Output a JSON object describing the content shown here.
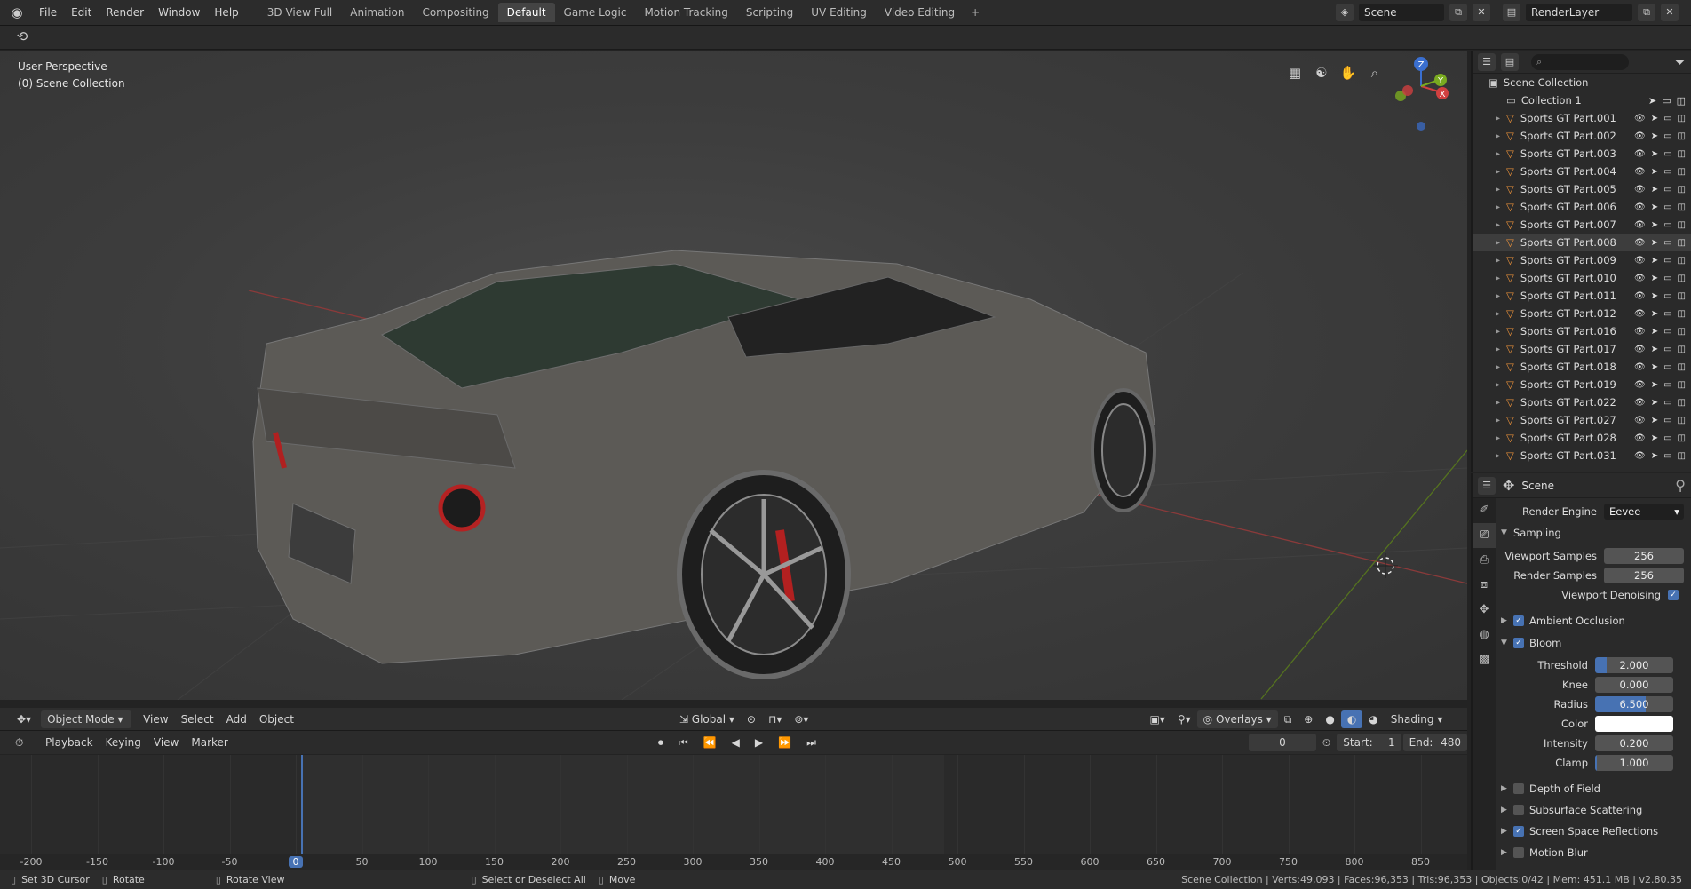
{
  "topbar": {
    "menus": [
      "File",
      "Edit",
      "Render",
      "Window",
      "Help"
    ],
    "workspaces": [
      "3D View Full",
      "Animation",
      "Compositing",
      "Default",
      "Game Logic",
      "Motion Tracking",
      "Scripting",
      "UV Editing",
      "Video Editing"
    ],
    "active_workspace": "Default",
    "add_label": "+",
    "scene": "Scene",
    "view_layer": "RenderLayer"
  },
  "viewport": {
    "perspective": "User Perspective",
    "collection": "(0) Scene Collection"
  },
  "vp_header": {
    "mode": "Object Mode",
    "menus": [
      "View",
      "Select",
      "Add",
      "Object"
    ],
    "orientation": "Global",
    "overlays": "Overlays",
    "shading": "Shading"
  },
  "timeline": {
    "menus": [
      "Playback",
      "Keying",
      "View",
      "Marker"
    ],
    "current_frame": "0",
    "start_label": "Start:",
    "start": "1",
    "end_label": "End:",
    "end": "480",
    "ruler": [
      "-200",
      "-150",
      "-100",
      "-50",
      "0",
      "50",
      "100",
      "150",
      "200",
      "250",
      "300",
      "350",
      "400",
      "450",
      "500",
      "550",
      "600",
      "650",
      "700",
      "750",
      "800",
      "850"
    ]
  },
  "statusbar": {
    "left": [
      {
        "label": "Set 3D Cursor"
      },
      {
        "label": "Rotate"
      },
      {
        "label": "Rotate View"
      },
      {
        "label": "Select or Deselect All"
      },
      {
        "label": "Move"
      }
    ],
    "stats": "Scene Collection | Verts:49,093 | Faces:96,353 | Tris:96,353 | Objects:0/42 | Mem: 451.1 MB | v2.80.35"
  },
  "outliner": {
    "root": "Scene Collection",
    "collection": "Collection 1",
    "items": [
      "Sports GT Part.001",
      "Sports GT Part.002",
      "Sports GT Part.003",
      "Sports GT Part.004",
      "Sports GT Part.005",
      "Sports GT Part.006",
      "Sports GT Part.007",
      "Sports GT Part.008",
      "Sports GT Part.009",
      "Sports GT Part.010",
      "Sports GT Part.011",
      "Sports GT Part.012",
      "Sports GT Part.016",
      "Sports GT Part.017",
      "Sports GT Part.018",
      "Sports GT Part.019",
      "Sports GT Part.022",
      "Sports GT Part.027",
      "Sports GT Part.028",
      "Sports GT Part.031"
    ],
    "selected_index": 7
  },
  "properties": {
    "context": "Scene",
    "render_engine_label": "Render Engine",
    "render_engine": "Eevee",
    "sampling_label": "Sampling",
    "viewport_samples_label": "Viewport Samples",
    "viewport_samples": "256",
    "render_samples_label": "Render Samples",
    "render_samples": "256",
    "viewport_denoising_label": "Viewport Denoising",
    "ambient_occlusion": "Ambient Occlusion",
    "bloom": "Bloom",
    "threshold_label": "Threshold",
    "threshold": "2.000",
    "knee_label": "Knee",
    "knee": "0.000",
    "radius_label": "Radius",
    "radius": "6.500",
    "color_label": "Color",
    "intensity_label": "Intensity",
    "intensity": "0.200",
    "clamp_label": "Clamp",
    "clamp": "1.000",
    "depth_of_field": "Depth of Field",
    "subsurface_scattering": "Subsurface Scattering",
    "screen_space_reflections": "Screen Space Reflections",
    "motion_blur": "Motion Blur"
  },
  "colors": {
    "accent": "#4772b3",
    "active_tab": "#444444",
    "timeline_cursor": "#4772b3",
    "axis_red": "#b33d3d",
    "axis_green": "#6c9a1e"
  }
}
